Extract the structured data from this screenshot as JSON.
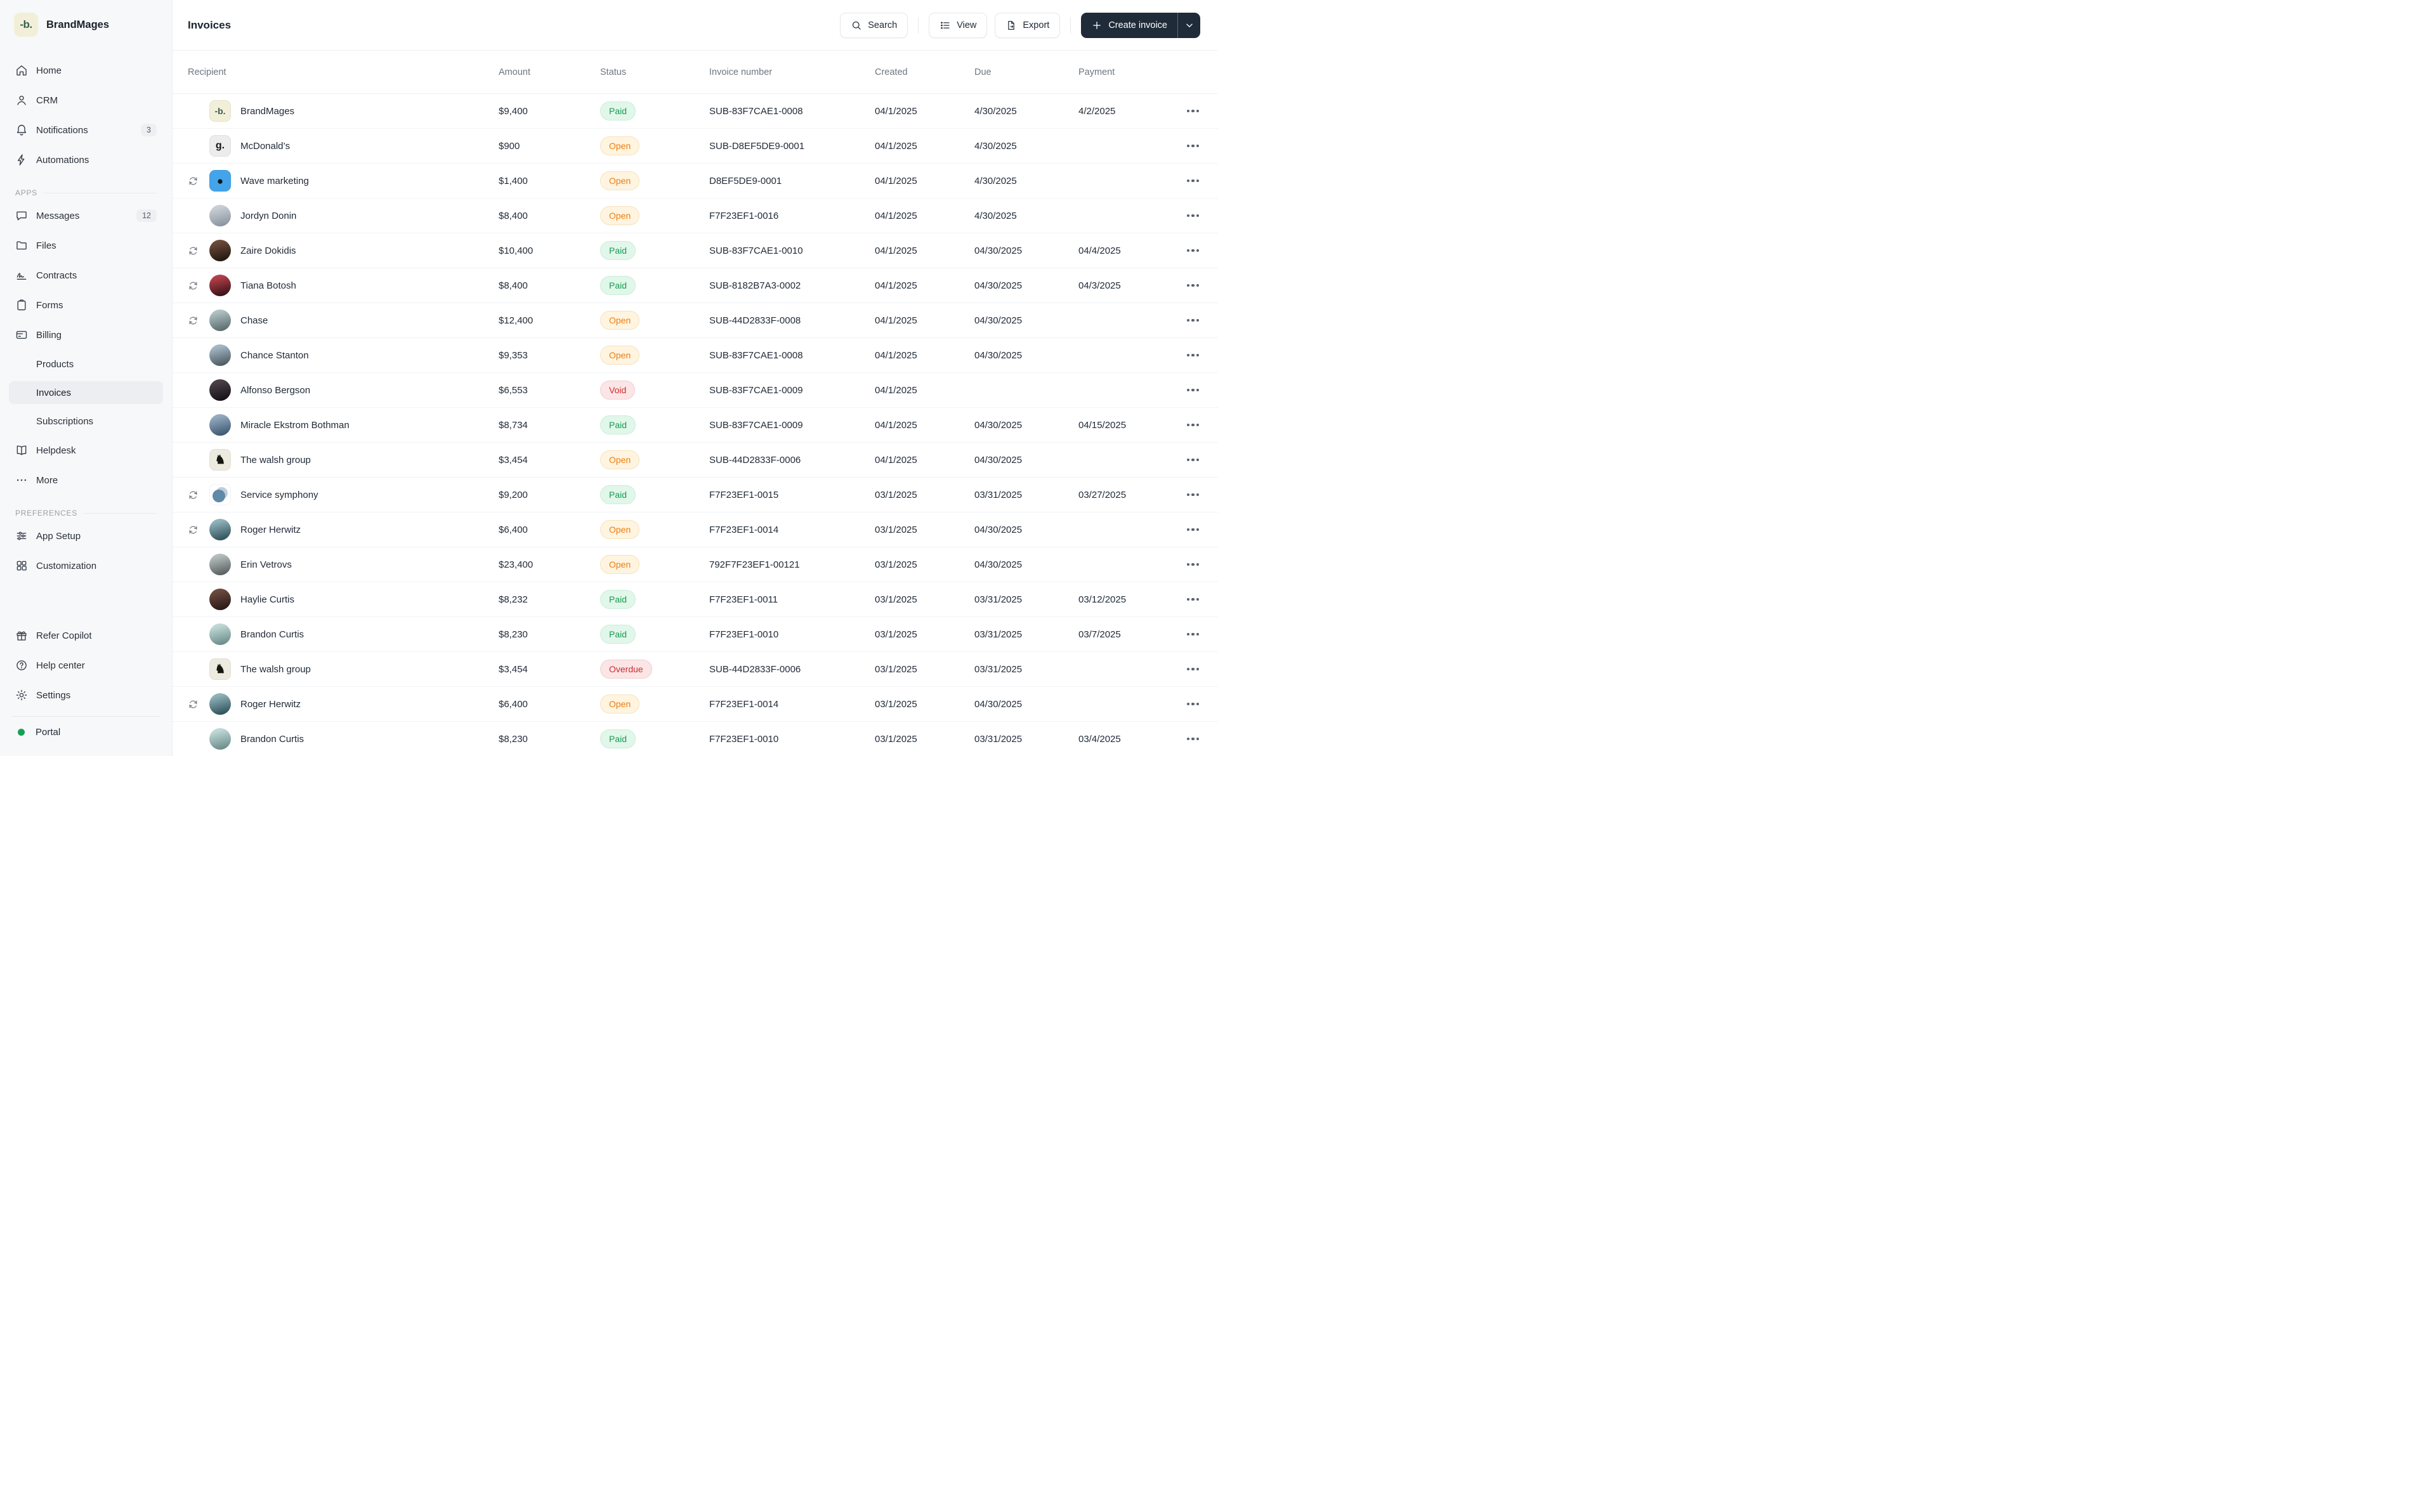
{
  "app": {
    "name": "BrandMages",
    "logo_glyph": "-b."
  },
  "sidebar": {
    "top_items": [
      {
        "label": "Home",
        "icon": "home"
      },
      {
        "label": "CRM",
        "icon": "user"
      },
      {
        "label": "Notifications",
        "icon": "bell",
        "badge": "3"
      },
      {
        "label": "Automations",
        "icon": "bolt"
      }
    ],
    "apps_label": "APPS",
    "apps_items": [
      {
        "label": "Messages",
        "icon": "chat",
        "badge": "12"
      },
      {
        "label": "Files",
        "icon": "folder"
      },
      {
        "label": "Contracts",
        "icon": "signature"
      },
      {
        "label": "Forms",
        "icon": "clipboard"
      },
      {
        "label": "Billing",
        "icon": "card"
      }
    ],
    "billing_children": [
      {
        "label": "Products",
        "active": false
      },
      {
        "label": "Invoices",
        "active": true
      },
      {
        "label": "Subscriptions",
        "active": false
      }
    ],
    "apps_items_after": [
      {
        "label": "Helpdesk",
        "icon": "book"
      },
      {
        "label": "More",
        "icon": "dots"
      }
    ],
    "preferences_label": "PREFERENCES",
    "preferences_items": [
      {
        "label": "App Setup",
        "icon": "sliders"
      },
      {
        "label": "Customization",
        "icon": "grid"
      }
    ],
    "footer_items": [
      {
        "label": "Refer Copilot",
        "icon": "gift"
      },
      {
        "label": "Help center",
        "icon": "help"
      },
      {
        "label": "Settings",
        "icon": "gear"
      }
    ],
    "portal_label": "Portal",
    "portal_dot_color": "#16A157"
  },
  "header": {
    "title": "Invoices",
    "search_label": "Search",
    "view_label": "View",
    "export_label": "Export",
    "create_label": "Create invoice"
  },
  "table": {
    "columns": [
      "Recipient",
      "Amount",
      "Status",
      "Invoice number",
      "Created",
      "Due",
      "Payment"
    ],
    "rows": [
      {
        "recipient": "BrandMages",
        "recurring": false,
        "amount": "$9,400",
        "status": "Paid",
        "invoice": "SUB-83F7CAE1-0008",
        "created": "04/1/2025",
        "due": "4/30/2025",
        "payment": "4/2/2025",
        "avatar": {
          "kind": "logo",
          "shape": "square",
          "bg": "#F2EFD9",
          "glyph": "-b.",
          "fg": "#3A5F4F",
          "size": 14
        }
      },
      {
        "recipient": "McDonald’s",
        "recurring": false,
        "amount": "$900",
        "status": "Open",
        "invoice": "SUB-D8EF5DE9-0001",
        "created": "04/1/2025",
        "due": "4/30/2025",
        "payment": "",
        "avatar": {
          "kind": "logo",
          "shape": "square",
          "bg": "#ECECEC",
          "glyph": "g.",
          "fg": "#141414",
          "size": 16
        }
      },
      {
        "recipient": "Wave marketing",
        "recurring": true,
        "amount": "$1,400",
        "status": "Open",
        "invoice": "D8EF5DE9-0001",
        "created": "04/1/2025",
        "due": "4/30/2025",
        "payment": "",
        "avatar": {
          "kind": "logo",
          "shape": "square",
          "bg": "#43A4EA",
          "glyph": "●",
          "fg": "#10151A",
          "size": 17
        }
      },
      {
        "recipient": "Jordyn Donin",
        "recurring": false,
        "amount": "$8,400",
        "status": "Open",
        "invoice": "F7F23EF1-0016",
        "created": "04/1/2025",
        "due": "4/30/2025",
        "payment": "",
        "avatar": {
          "kind": "photo",
          "shape": "circle",
          "bg": "#C9CED5",
          "bg2": "#8C96A1"
        }
      },
      {
        "recipient": "Zaire Dokidis",
        "recurring": true,
        "amount": "$10,400",
        "status": "Paid",
        "invoice": "SUB-83F7CAE1-0010",
        "created": "04/1/2025",
        "due": "04/30/2025",
        "payment": "04/4/2025",
        "avatar": {
          "kind": "photo",
          "shape": "circle",
          "bg": "#6B4A3A",
          "bg2": "#241811"
        }
      },
      {
        "recipient": "Tiana Botosh",
        "recurring": true,
        "amount": "$8,400",
        "status": "Paid",
        "invoice": "SUB-8182B7A3-0002",
        "created": "04/1/2025",
        "due": "04/30/2025",
        "payment": "04/3/2025",
        "avatar": {
          "kind": "photo",
          "shape": "circle",
          "bg": "#B24048",
          "bg2": "#3C1318"
        }
      },
      {
        "recipient": "Chase",
        "recurring": true,
        "amount": "$12,400",
        "status": "Open",
        "invoice": "SUB-44D2833F-0008",
        "created": "04/1/2025",
        "due": "04/30/2025",
        "payment": "",
        "avatar": {
          "kind": "photo",
          "shape": "circle",
          "bg": "#AEC0C2",
          "bg2": "#5C6E70"
        }
      },
      {
        "recipient": "Chance Stanton",
        "recurring": false,
        "amount": "$9,353",
        "status": "Open",
        "invoice": "SUB-83F7CAE1-0008",
        "created": "04/1/2025",
        "due": "04/30/2025",
        "payment": "",
        "avatar": {
          "kind": "photo",
          "shape": "circle",
          "bg": "#A3B7C3",
          "bg2": "#4F5B63"
        }
      },
      {
        "recipient": "Alfonso Bergson",
        "recurring": false,
        "amount": "$6,553",
        "status": "Void",
        "invoice": "SUB-83F7CAE1-0009",
        "created": "04/1/2025",
        "due": "",
        "payment": "",
        "avatar": {
          "kind": "photo",
          "shape": "circle",
          "bg": "#4A4046",
          "bg2": "#17121A"
        }
      },
      {
        "recipient": "Miracle Ekstrom Bothman",
        "recurring": false,
        "amount": "$8,734",
        "status": "Paid",
        "invoice": "SUB-83F7CAE1-0009",
        "created": "04/1/2025",
        "due": "04/30/2025",
        "payment": "04/15/2025",
        "avatar": {
          "kind": "photo",
          "shape": "circle",
          "bg": "#93A9BE",
          "bg2": "#3F5A75"
        }
      },
      {
        "recipient": "The walsh group",
        "recurring": false,
        "amount": "$3,454",
        "status": "Open",
        "invoice": "SUB-44D2833F-0006",
        "created": "04/1/2025",
        "due": "04/30/2025",
        "payment": "",
        "avatar": {
          "kind": "logo",
          "shape": "square",
          "bg": "#EDEAE0",
          "glyph": "♞",
          "fg": "#17150F",
          "size": 19
        }
      },
      {
        "recipient": "Service symphony",
        "recurring": true,
        "amount": "$9,200",
        "status": "Paid",
        "invoice": "F7F23EF1-0015",
        "created": "03/1/2025",
        "due": "03/31/2025",
        "payment": "03/27/2025",
        "avatar": {
          "kind": "circles",
          "shape": "square",
          "bg": "#FFFFFF",
          "c1": "#BCCFDB",
          "c2": "#5E89A8"
        }
      },
      {
        "recipient": "Roger Herwitz",
        "recurring": true,
        "amount": "$6,400",
        "status": "Open",
        "invoice": "F7F23EF1-0014",
        "created": "03/1/2025",
        "due": "04/30/2025",
        "payment": "",
        "avatar": {
          "kind": "photo",
          "shape": "circle",
          "bg": "#8FB2BA",
          "bg2": "#32545C"
        }
      },
      {
        "recipient": "Erin Vetrovs",
        "recurring": false,
        "amount": "$23,400",
        "status": "Open",
        "invoice": "792F7F23EF1-00121",
        "created": "03/1/2025",
        "due": "04/30/2025",
        "payment": "",
        "avatar": {
          "kind": "photo",
          "shape": "circle",
          "bg": "#B4BCBC",
          "bg2": "#5A6362"
        }
      },
      {
        "recipient": "Haylie Curtis",
        "recurring": false,
        "amount": "$8,232",
        "status": "Paid",
        "invoice": "F7F23EF1-0011",
        "created": "03/1/2025",
        "due": "03/31/2025",
        "payment": "03/12/2025",
        "avatar": {
          "kind": "photo",
          "shape": "circle",
          "bg": "#6B4A40",
          "bg2": "#2A1A16"
        }
      },
      {
        "recipient": "Brandon Curtis",
        "recurring": false,
        "amount": "$8,230",
        "status": "Paid",
        "invoice": "F7F23EF1-0010",
        "created": "03/1/2025",
        "due": "03/31/2025",
        "payment": "03/7/2025",
        "avatar": {
          "kind": "photo",
          "shape": "circle",
          "bg": "#BFD8D6",
          "bg2": "#6E8F8C"
        }
      },
      {
        "recipient": "The walsh group",
        "recurring": false,
        "amount": "$3,454",
        "status": "Overdue",
        "invoice": "SUB-44D2833F-0006",
        "created": "03/1/2025",
        "due": "03/31/2025",
        "payment": "",
        "avatar": {
          "kind": "logo",
          "shape": "square",
          "bg": "#EDEAE0",
          "glyph": "♞",
          "fg": "#17150F",
          "size": 19
        }
      },
      {
        "recipient": "Roger Herwitz",
        "recurring": true,
        "amount": "$6,400",
        "status": "Open",
        "invoice": "F7F23EF1-0014",
        "created": "03/1/2025",
        "due": "04/30/2025",
        "payment": "",
        "avatar": {
          "kind": "photo",
          "shape": "circle",
          "bg": "#8FB2BA",
          "bg2": "#32545C"
        }
      },
      {
        "recipient": "Brandon Curtis",
        "recurring": false,
        "amount": "$8,230",
        "status": "Paid",
        "invoice": "F7F23EF1-0010",
        "created": "03/1/2025",
        "due": "03/31/2025",
        "payment": "03/4/2025",
        "avatar": {
          "kind": "photo",
          "shape": "circle",
          "bg": "#BFD8D6",
          "bg2": "#6E8F8C"
        }
      }
    ]
  },
  "status_styles": {
    "Paid": {
      "bg": "#E1F7EA",
      "border": "#C9EEDB",
      "fg": "#189A52"
    },
    "Open": {
      "bg": "#FEF4DF",
      "border": "#F6E3BE",
      "fg": "#EE7D12"
    },
    "Void": {
      "bg": "#FBE5E6",
      "border": "#F3CFD1",
      "fg": "#D42B2B"
    },
    "Overdue": {
      "bg": "#FBE5E6",
      "border": "#F3CFD1",
      "fg": "#CE2C31"
    }
  }
}
